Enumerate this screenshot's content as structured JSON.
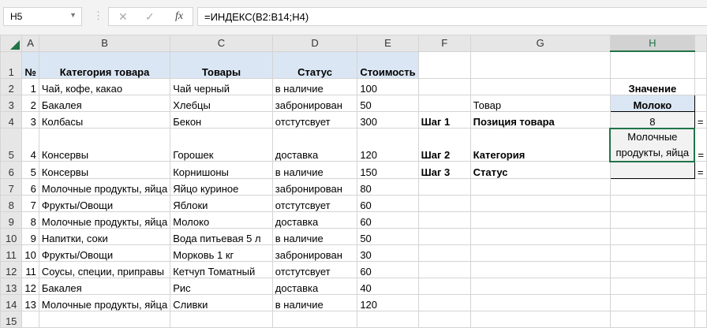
{
  "formula_bar": {
    "name_box": "H5",
    "formula": "=ИНДЕКС(B2:B14;H4)",
    "cancel": "✕",
    "enter": "✓",
    "fx": "fx"
  },
  "columns": [
    "A",
    "B",
    "C",
    "D",
    "E",
    "F",
    "G",
    "H"
  ],
  "headers": {
    "a": "№",
    "b": "Категория товара",
    "c": "Товары",
    "d": "Статус",
    "e": "Стоимость"
  },
  "rows": [
    [
      "1",
      "Чай, кофе, какао",
      "Чай черный",
      "в наличие",
      "100"
    ],
    [
      "2",
      "Бакалея",
      "Хлебцы",
      "забронирован",
      "50"
    ],
    [
      "3",
      "Колбасы",
      "Бекон",
      "отстутсвует",
      "300"
    ],
    [
      "4",
      "Консервы",
      "Горошек",
      "доставка",
      "120"
    ],
    [
      "5",
      "Консервы",
      "Корнишоны",
      "в наличие",
      "150"
    ],
    [
      "6",
      "Молочные продукты, яйца",
      "Яйцо куриное",
      "забронирован",
      "80"
    ],
    [
      "7",
      "Фрукты/Овощи",
      "Яблоки",
      "отстутсвует",
      "60"
    ],
    [
      "8",
      "Молочные продукты, яйца",
      "Молоко",
      "доставка",
      "60"
    ],
    [
      "9",
      "Напитки, соки",
      "Вода питьевая 5 л",
      "в наличие",
      "50"
    ],
    [
      "10",
      "Фрукты/Овощи",
      "Морковь 1 кг",
      "забронирован",
      "30"
    ],
    [
      "11",
      "Соусы, специи, приправы",
      "Кетчуп Томатный",
      "отстутсвует",
      "60"
    ],
    [
      "12",
      "Бакалея",
      "Рис",
      "доставка",
      "40"
    ],
    [
      "13",
      "Молочные продукты, яйца",
      "Сливки",
      "в наличие",
      "120"
    ]
  ],
  "lookup": {
    "value_header": "Значение",
    "product_label": "Товар",
    "product_value": "Молоко",
    "step1": "Шаг 1",
    "position_label": "Позиция товара",
    "position_value": "8",
    "step2": "Шаг 2",
    "category_label": "Категория",
    "category_value": "Молочные продукты, яйца",
    "step3": "Шаг 3",
    "status_label": "Статус",
    "status_value": "",
    "overflow": "="
  },
  "row_numbers": [
    "1",
    "2",
    "3",
    "4",
    "5",
    "6",
    "7",
    "8",
    "9",
    "10",
    "11",
    "12",
    "13",
    "14",
    "15"
  ]
}
